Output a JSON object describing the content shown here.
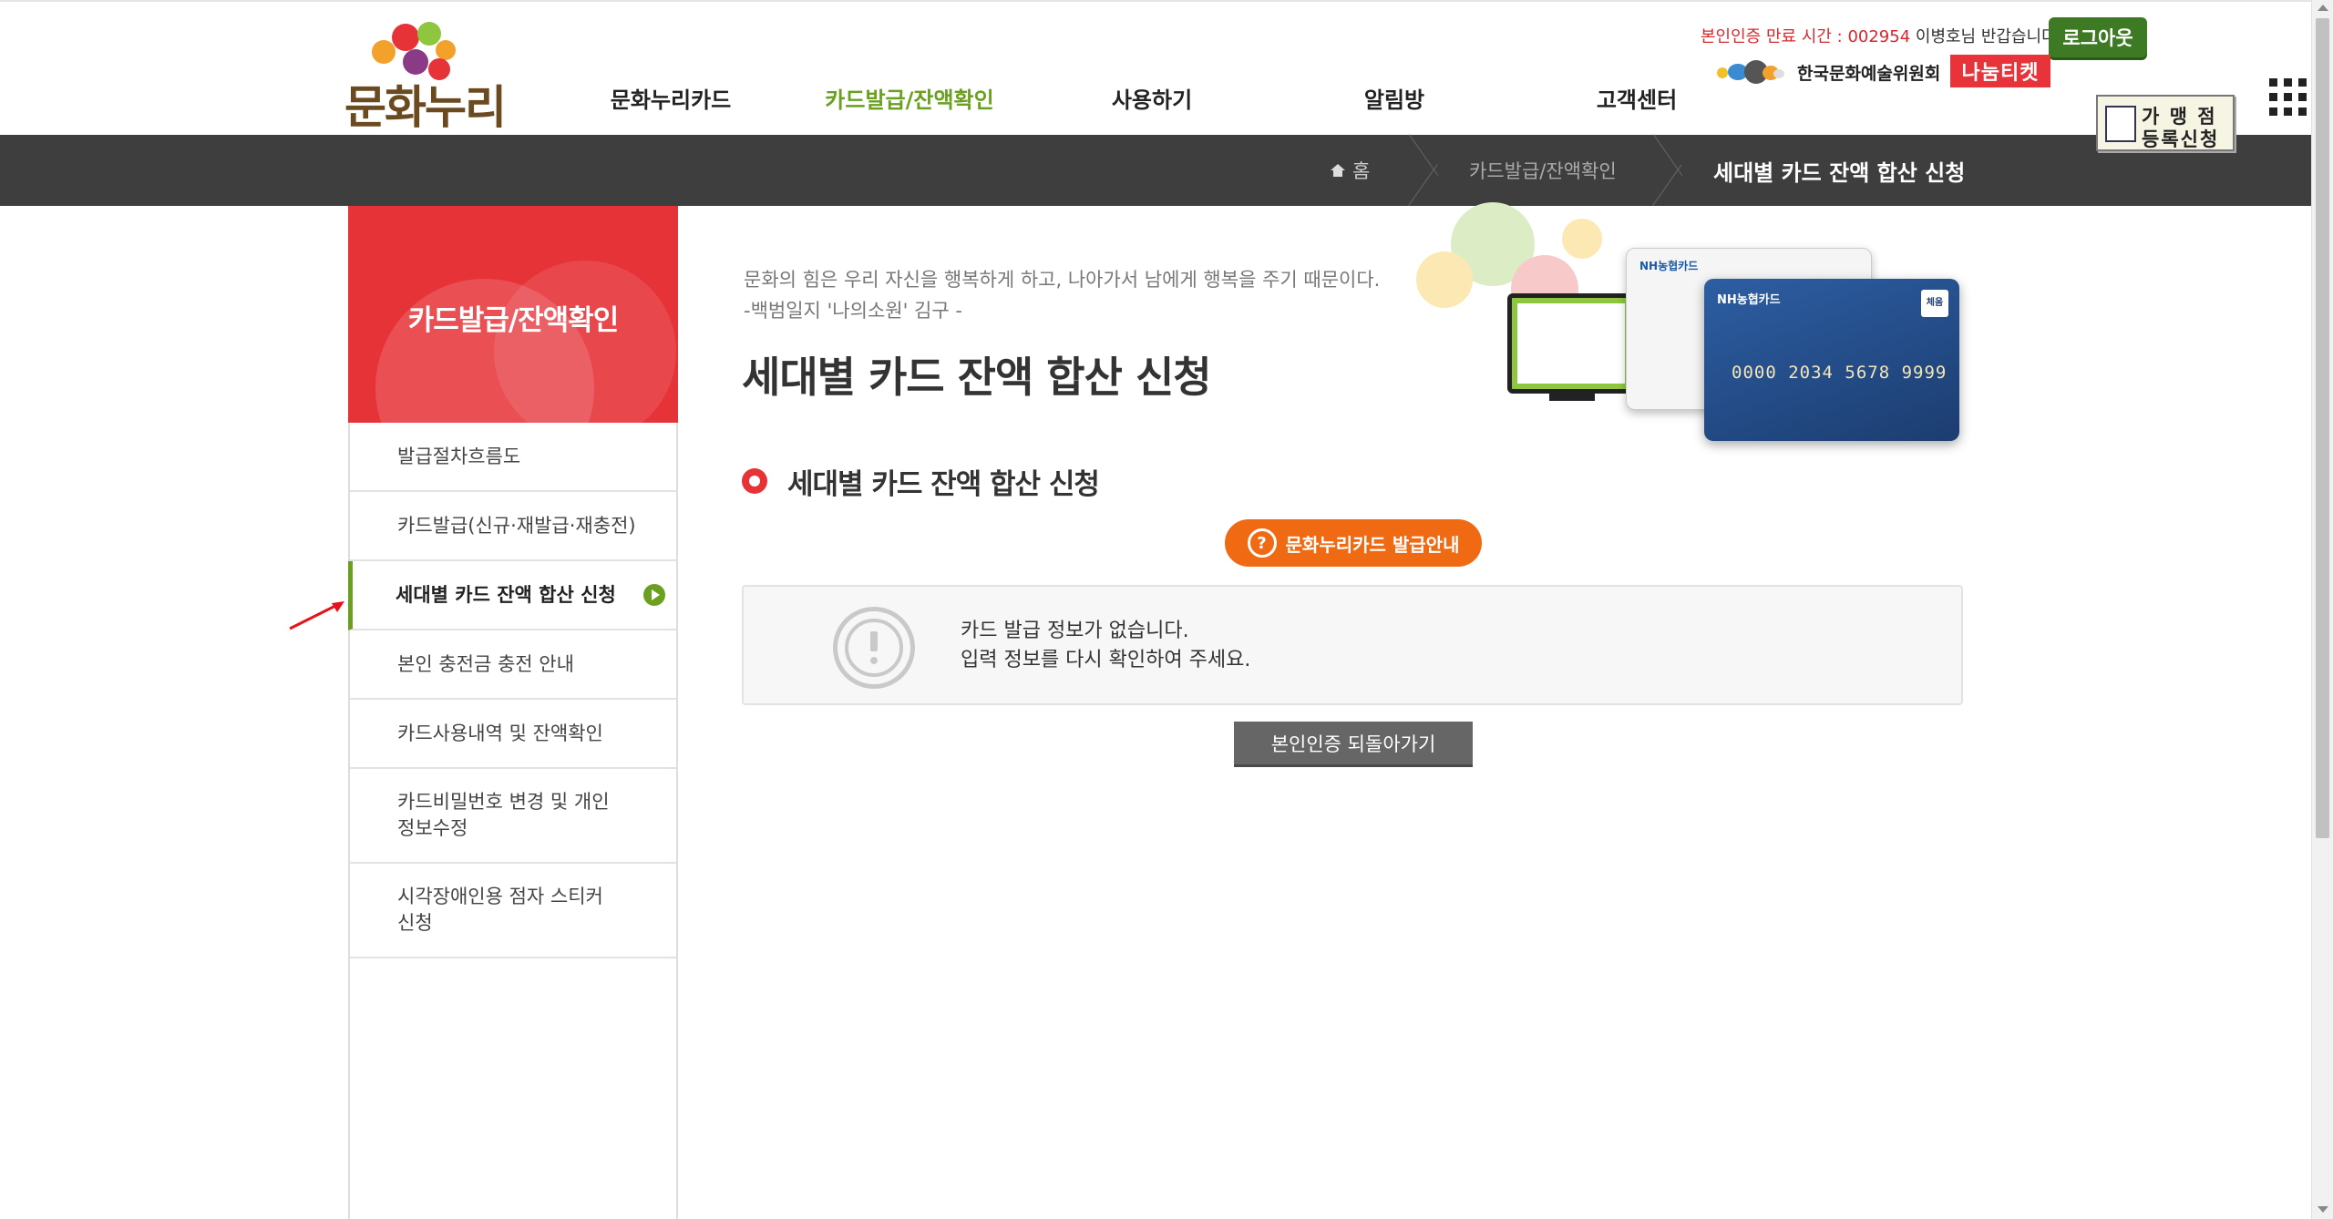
{
  "header": {
    "logo_text": "문화누리",
    "nav": [
      {
        "label": "문화누리카드",
        "active": false
      },
      {
        "label": "카드발급/잔액확인",
        "active": true
      },
      {
        "label": "사용하기",
        "active": false
      },
      {
        "label": "알림방",
        "active": false
      },
      {
        "label": "고객센터",
        "active": false
      }
    ],
    "session": {
      "timer_label": "본인인증 만료 시간 : ",
      "timer_value": "002954",
      "greeting": " 이병호님 반갑습니다."
    },
    "logout_label": "로그아웃",
    "arko_label": "한국문화예술위원회",
    "nanum_label": "나눔티켓",
    "merchant_line1": "가 맹 점",
    "merchant_line2": "등록신청",
    "accent_color": "#6a9f1f"
  },
  "breadcrumb": {
    "home": "홈",
    "middle": "카드발급/잔액확인",
    "current": "세대별 카드 잔액 합산 신청"
  },
  "sidebar": {
    "title": "카드발급/잔액확인",
    "items": [
      {
        "label": "발급절차흐름도"
      },
      {
        "label": "카드발급(신규·재발급·재충전)"
      },
      {
        "label": "세대별 카드 잔액 합산 신청",
        "active": true
      },
      {
        "label": "본인 충전금 충전 안내"
      },
      {
        "label": "카드사용내역 및 잔액확인"
      },
      {
        "label": "카드비밀번호 변경 및 개인 정보수정"
      },
      {
        "label": "시각장애인용 점자 스티커 신청"
      }
    ]
  },
  "main": {
    "quote_line1": "문화의 힘은 우리 자신을 행복하게 하고, 나아가서 남에게 행복을 주기 때문이다.",
    "quote_line2": "-백범일지 '나의소원' 김구 -",
    "page_title": "세대별 카드 잔액 합산 신청",
    "section_title": "세대별 카드 잔액 합산 신청",
    "guide_button": "문화누리카드 발급안내",
    "message_line1": "카드 발급 정보가 없습니다.",
    "message_line2": "입력 정보를 다시 확인하여 주세요.",
    "back_button": "본인인증 되돌아가기",
    "card": {
      "brand": "NH농협카드",
      "number": "0000 2034 5678 9999"
    }
  }
}
